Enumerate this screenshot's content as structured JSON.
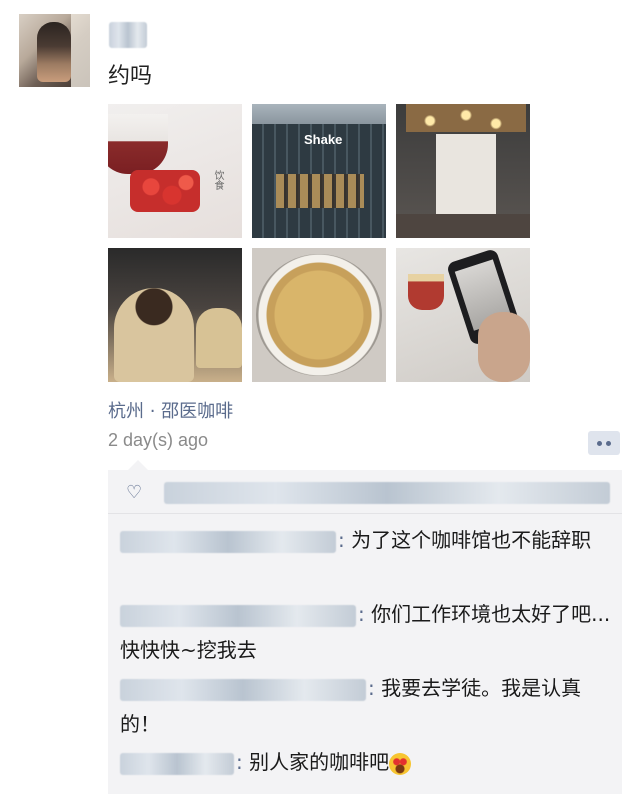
{
  "post": {
    "text": "约吗",
    "location": "杭州 · 邵医咖啡",
    "time": "2 day(s) ago",
    "photos": [
      {
        "id": 1,
        "overlay_text": "饮食"
      },
      {
        "id": 2,
        "overlay_text": "Shake"
      },
      {
        "id": 3,
        "overlay_text": ""
      },
      {
        "id": 4,
        "overlay_text": ""
      },
      {
        "id": 5,
        "overlay_text": ""
      },
      {
        "id": 6,
        "overlay_text": ""
      }
    ]
  },
  "icons": {
    "heart": "heart-icon",
    "comment": "comment-icon",
    "emoji": "star-struck-emoji-icon"
  },
  "comments": [
    {
      "text": "为了这个咖啡馆也不能辞职"
    },
    {
      "text": "你们工作环境也太好了吧...快快快~挖我去"
    },
    {
      "text": "我要去学徒。我是认真的！"
    },
    {
      "text": "别人家的咖啡吧"
    }
  ],
  "colors": {
    "link": "#5a6b8c",
    "comment_bg": "#f3f3f5",
    "time": "#8a8a8a"
  }
}
